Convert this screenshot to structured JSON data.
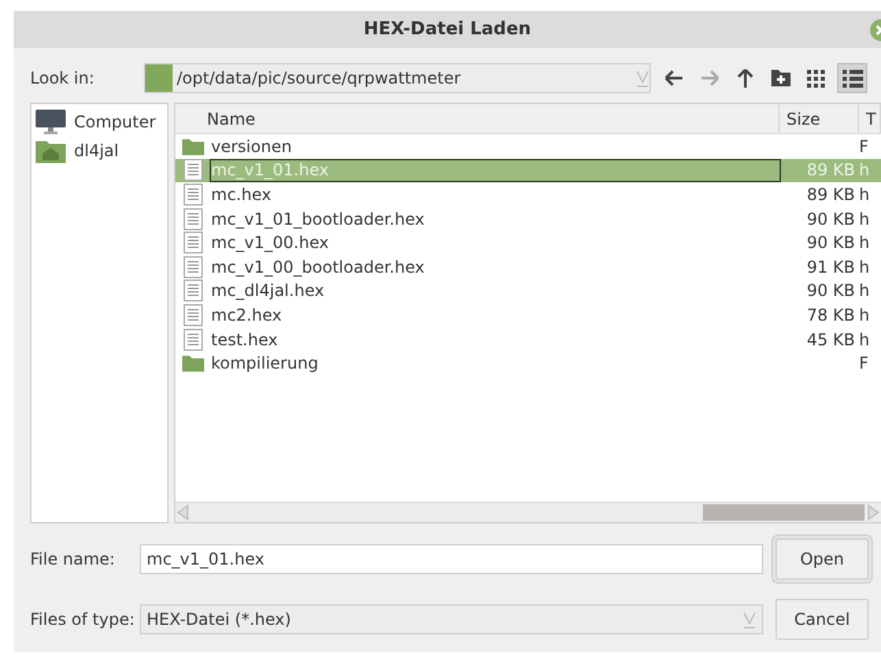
{
  "window": {
    "title": "HEX-Datei Laden"
  },
  "look_in": {
    "label": "Look in:",
    "path": "/opt/data/pic/source/qrpwattmeter"
  },
  "toolbar": [
    {
      "kind": "back",
      "disabled": false
    },
    {
      "kind": "forward",
      "disabled": true
    },
    {
      "kind": "up",
      "disabled": false
    },
    {
      "kind": "new-folder",
      "disabled": false
    },
    {
      "kind": "grid",
      "selected": false
    },
    {
      "kind": "list",
      "selected": true
    }
  ],
  "sidebar": {
    "items": [
      {
        "label": "Computer",
        "kind": "computer"
      },
      {
        "label": "dl4jal",
        "kind": "home"
      }
    ]
  },
  "table": {
    "columns": [
      "Name",
      "Size",
      "T"
    ],
    "rows": [
      {
        "kind": "folder",
        "name": "versionen",
        "size": "",
        "type": "F",
        "selected": false
      },
      {
        "kind": "file",
        "name": "mc_v1_01.hex",
        "size": "89 KB",
        "type": "h",
        "selected": true
      },
      {
        "kind": "file",
        "name": "mc.hex",
        "size": "89 KB",
        "type": "h",
        "selected": false
      },
      {
        "kind": "file",
        "name": "mc_v1_01_bootloader.hex",
        "size": "90 KB",
        "type": "h",
        "selected": false
      },
      {
        "kind": "file",
        "name": "mc_v1_00.hex",
        "size": "90 KB",
        "type": "h",
        "selected": false
      },
      {
        "kind": "file",
        "name": "mc_v1_00_bootloader.hex",
        "size": "91 KB",
        "type": "h",
        "selected": false
      },
      {
        "kind": "file",
        "name": "mc_dl4jal.hex",
        "size": "90 KB",
        "type": "h",
        "selected": false
      },
      {
        "kind": "file",
        "name": "mc2.hex",
        "size": "78 KB",
        "type": "h",
        "selected": false
      },
      {
        "kind": "file",
        "name": "test.hex",
        "size": "45 KB",
        "type": "h",
        "selected": false
      },
      {
        "kind": "folder",
        "name": "kompilierung",
        "size": "",
        "type": "F",
        "selected": false
      }
    ]
  },
  "file_name": {
    "label": "File name:",
    "value": "mc_v1_01.hex"
  },
  "file_type": {
    "label": "Files of type:",
    "value": "HEX-Datei (*.hex)"
  },
  "buttons": [
    "Open",
    "Cancel"
  ]
}
